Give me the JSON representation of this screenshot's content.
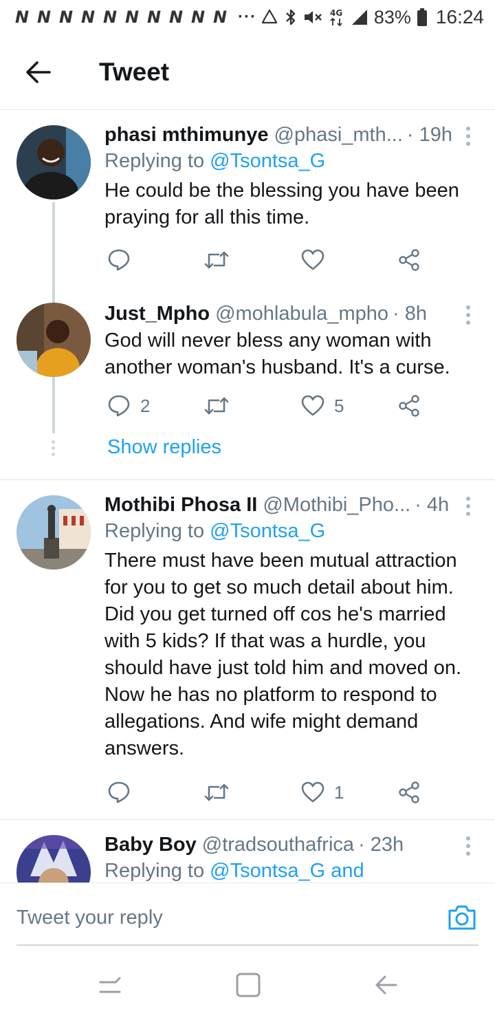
{
  "status_bar": {
    "notification_icons": [
      "N",
      "N",
      "N",
      "N",
      "N",
      "N",
      "N",
      "N",
      "N",
      "N"
    ],
    "more_indicator": "···",
    "battery_percent": "83%",
    "time": "16:24",
    "icons": [
      "recycle-icon",
      "bluetooth-icon",
      "mute-icon",
      "4g-icon",
      "signal-icon",
      "battery-icon"
    ]
  },
  "header": {
    "title": "Tweet"
  },
  "tweets": [
    {
      "name": "phasi mthimunye",
      "handle": "@phasi_mth...",
      "time": "· 19h",
      "replying_prefix": "Replying to ",
      "replying_to": "@Tsontsa_G",
      "text": "He could be the blessing you have been praying for all this time.",
      "reply_count": "",
      "like_count": ""
    },
    {
      "name": "Just_Mpho",
      "handle": "@mohlabula_mpho",
      "time": "· 8h",
      "text": "God will never bless any woman with another woman's husband. It's a curse.",
      "reply_count": "2",
      "like_count": "5"
    },
    {
      "name": "Mothibi Phosa II",
      "handle": "@Mothibi_Pho...",
      "time": "· 4h",
      "replying_prefix": "Replying to ",
      "replying_to": "@Tsontsa_G",
      "text": "There must have been mutual attraction for you to get so much detail about him. Did you get turned off cos he's married with 5 kids? If that was a hurdle, you should have just told him and moved on. Now he has no platform to respond to allegations. And wife might demand answers.",
      "reply_count": "",
      "like_count": "1"
    },
    {
      "name": "Baby Boy",
      "handle": "@tradsouthafrica",
      "time": "· 23h",
      "replying_prefix": "Replying to ",
      "replying_to": "@Tsontsa_G and"
    }
  ],
  "show_replies": "Show replies",
  "composer": {
    "placeholder": "Tweet your reply"
  },
  "colors": {
    "accent": "#1da1f2",
    "secondary_text": "#657786",
    "primary_text": "#14171a",
    "divider": "#e1e8ed"
  }
}
